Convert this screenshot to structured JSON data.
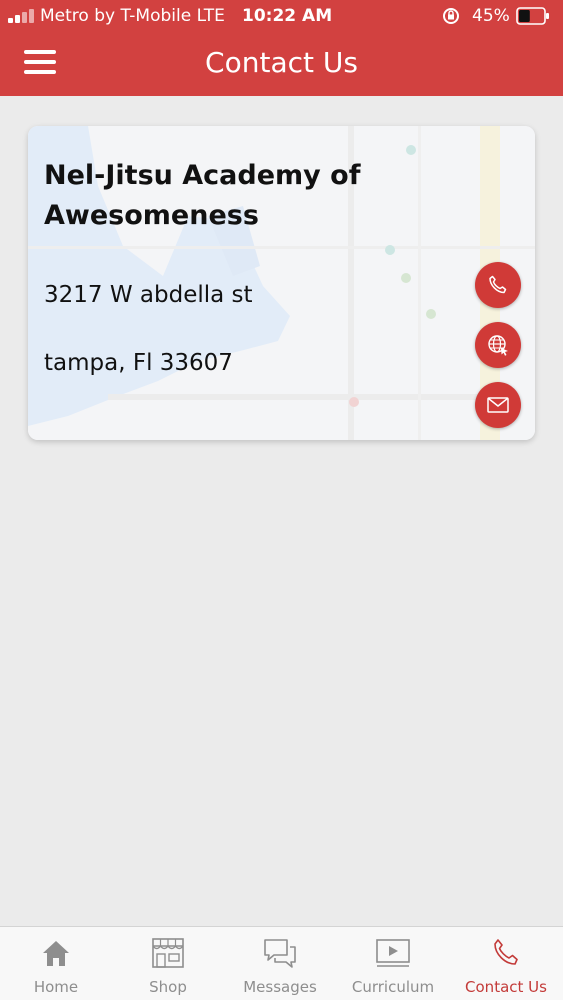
{
  "status_bar": {
    "carrier": "Metro by T-Mobile  LTE",
    "time": "10:22 AM",
    "battery_percent": "45%",
    "battery_level": 0.45,
    "icons": [
      "signal-icon",
      "orientation-lock-icon",
      "battery-icon"
    ]
  },
  "header": {
    "title": "Contact Us",
    "menu_icon": "hamburger-menu-icon",
    "color": "#d24140"
  },
  "contact": {
    "name": "Nel-Jitsu Academy of Awesomeness",
    "address_line1": "3217 W abdella st",
    "address_line2": "tampa, Fl 33607",
    "actions": [
      {
        "id": "call",
        "icon": "phone-icon"
      },
      {
        "id": "website",
        "icon": "globe-icon"
      },
      {
        "id": "email",
        "icon": "envelope-icon"
      }
    ],
    "action_color": "#d03a37"
  },
  "tabs": [
    {
      "label": "Home",
      "icon": "home-icon",
      "active": false
    },
    {
      "label": "Shop",
      "icon": "shop-icon",
      "active": false
    },
    {
      "label": "Messages",
      "icon": "messages-icon",
      "active": false
    },
    {
      "label": "Curriculum",
      "icon": "video-icon",
      "active": false
    },
    {
      "label": "Contact Us",
      "icon": "phone-icon",
      "active": true
    }
  ],
  "colors": {
    "accent": "#d24140",
    "tab_inactive": "#8e8e8e",
    "tab_active": "#c33b39",
    "background": "#ebebeb"
  }
}
